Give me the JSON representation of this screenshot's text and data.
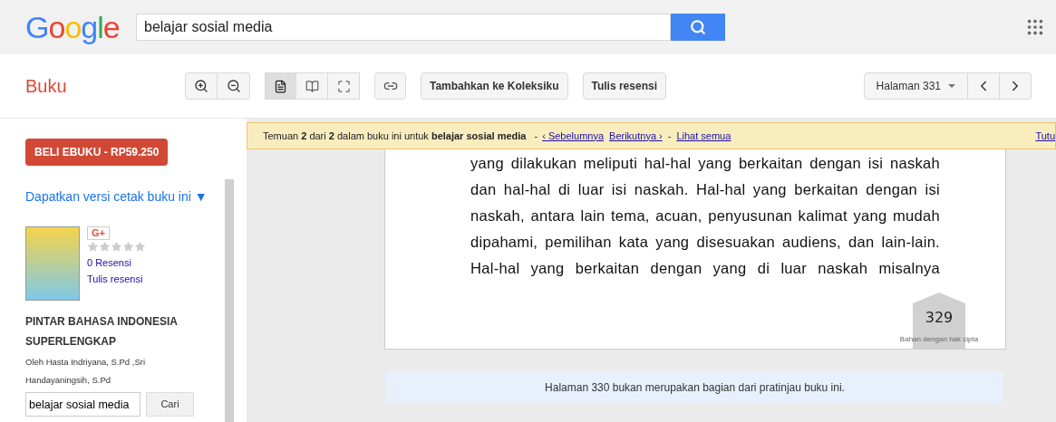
{
  "header": {
    "logo": "Google",
    "search": {
      "value": "belajar sosial media"
    }
  },
  "toolbar": {
    "title": "Buku",
    "view_modes": [
      {
        "kind": "single",
        "selected": true
      },
      {
        "kind": "double",
        "selected": false
      },
      {
        "kind": "fullscreen",
        "selected": false
      }
    ],
    "add_button": "Tambahkan ke Koleksiku",
    "review_button": "Tulis resensi",
    "page_select": "Halaman 331"
  },
  "sidebar": {
    "buy_button": "BELI EBUKU - RP59.250",
    "print_link": "Dapatkan versi cetak buku ini ▼",
    "gplus": "G+",
    "stars": 0,
    "reviews_link": "0 Resensi",
    "write_review_link": "Tulis resensi",
    "book_title": "PINTAR BAHASA INDONESIA SUPERLENGKAP",
    "author": "Oleh Hasta Indriyana, S.Pd ,Sri Handayaningsih, S.Pd",
    "search": {
      "value": "belajar sosial media"
    },
    "search_button": "Cari"
  },
  "banner": {
    "text": "Temuan **2** dari **2** dalam buku ini untuk **belajar sosial media**",
    "sep1": "-",
    "prev_link": "‹ Sebelumnya",
    "next_link": "Berikutnya ›",
    "sep2": "-",
    "all_link": "Lihat semua",
    "close_link": "Tutu"
  },
  "page": {
    "body": "yang dilakukan meliputi hal-hal yang berkaitan dengan isi naskah dan hal-hal di luar isi naskah. Hal-hal yang berkaitan dengan isi naskah, antara lain tema, acuan, penyusunan kalimat yang mudah dipahami, pemilihan kata yang disesuakan audiens, dan lain-lain. Hal-hal yang berkaitan dengan yang di luar naskah misalnya",
    "page_number": "329",
    "copyright": "Bahan dengan hak cipta"
  },
  "notice": "Halaman 330 bukan merupakan bagian dari pratinjau buku ini."
}
